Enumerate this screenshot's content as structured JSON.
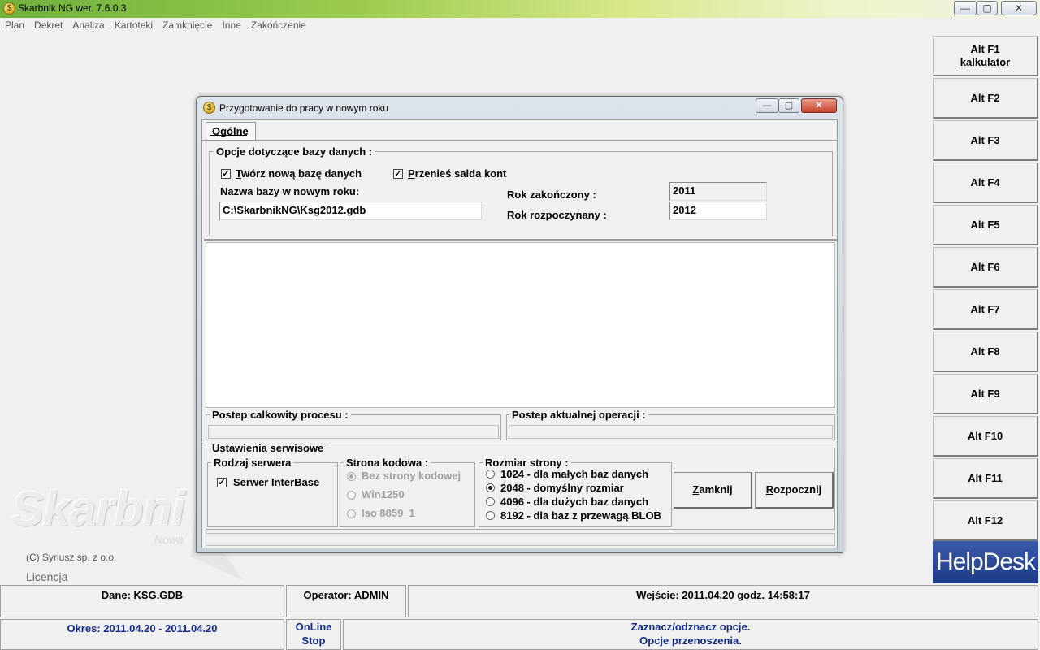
{
  "window": {
    "title": "Skarbnik NG wer. 7.6.0.3",
    "min": "—",
    "max": "▢",
    "close": "✕",
    "icon_glyph": "$"
  },
  "menu": [
    "Plan",
    "Dekret",
    "Analiza",
    "Kartoteki",
    "Zamknięcie",
    "Inne",
    "Zakończenie"
  ],
  "workspace": {
    "logo": "Skarbni",
    "logo_sub": "Nowa",
    "copyright": "(C) Syriusz sp. z o.o.",
    "license": "Licencja"
  },
  "fkeys": [
    {
      "line1": "Alt F1",
      "line2": "kalkulator"
    },
    {
      "line1": "Alt F2",
      "line2": ""
    },
    {
      "line1": "Alt F3",
      "line2": ""
    },
    {
      "line1": "Alt F4",
      "line2": ""
    },
    {
      "line1": "Alt F5",
      "line2": ""
    },
    {
      "line1": "Alt F6",
      "line2": ""
    },
    {
      "line1": "Alt F7",
      "line2": ""
    },
    {
      "line1": "Alt F8",
      "line2": ""
    },
    {
      "line1": "Alt F9",
      "line2": ""
    },
    {
      "line1": "Alt F10",
      "line2": ""
    },
    {
      "line1": "Alt F11",
      "line2": ""
    },
    {
      "line1": "Alt F12",
      "line2": ""
    }
  ],
  "helpdesk": "HelpDesk",
  "status": {
    "dane": "Dane: KSG.GDB",
    "operator": "Operator: ADMIN",
    "wejscie": "Wejście: 2011.04.20 godz. 14:58:17",
    "okres": "Okres: 2011.04.20 - 2011.04.20",
    "online": "OnLine",
    "stop": "Stop",
    "hint1": "Zaznacz/odznacz opcje.",
    "hint2": "Opcje przenoszenia."
  },
  "dialog": {
    "title": "Przygotowanie do pracy w nowym roku",
    "tab": "Ogólne",
    "db_group": "Opcje dotyczące bazy danych :",
    "create_db": {
      "pre": "T",
      "rest": "wórz nową bazę danych",
      "checked": true
    },
    "transfer": {
      "pre": "P",
      "rest": "rzenieś salda kont",
      "checked": true
    },
    "db_name_label": "Nazwa bazy w nowym roku:",
    "db_name_value": "C:\\SkarbnikNG\\Ksg2012.gdb",
    "year_closed_label": "Rok zakończony :",
    "year_closed_value": "2011",
    "year_started_label": "Rok rozpoczynany :",
    "year_started_value": "2012",
    "progress_total_label": "Postep calkowity procesu :",
    "progress_current_label": "Postep aktualnej operacji :",
    "service_group": "Ustawienia serwisowe",
    "server_type_group": "Rodzaj serwera",
    "server_interbase": {
      "label": "Serwer InterBase",
      "checked": true
    },
    "codepage_group": "Strona kodowa :",
    "codepages": [
      {
        "label": "Bez strony kodowej",
        "selected": true
      },
      {
        "label": "Win1250",
        "selected": false
      },
      {
        "label": "Iso 8859_1",
        "selected": false
      }
    ],
    "pagesize_group": "Rozmiar strony :",
    "pagesizes": [
      {
        "label": "1024 - dla małych baz danych",
        "selected": false
      },
      {
        "label": "2048 - domyślny rozmiar",
        "selected": true
      },
      {
        "label": "4096 - dla dużych baz danych",
        "selected": false
      },
      {
        "label": "8192 - dla baz z przewagą BLOB",
        "selected": false
      }
    ],
    "close_btn": {
      "pre": "Z",
      "rest": "amknij"
    },
    "start_btn": {
      "pre": "R",
      "rest": "ozpocznij"
    }
  }
}
